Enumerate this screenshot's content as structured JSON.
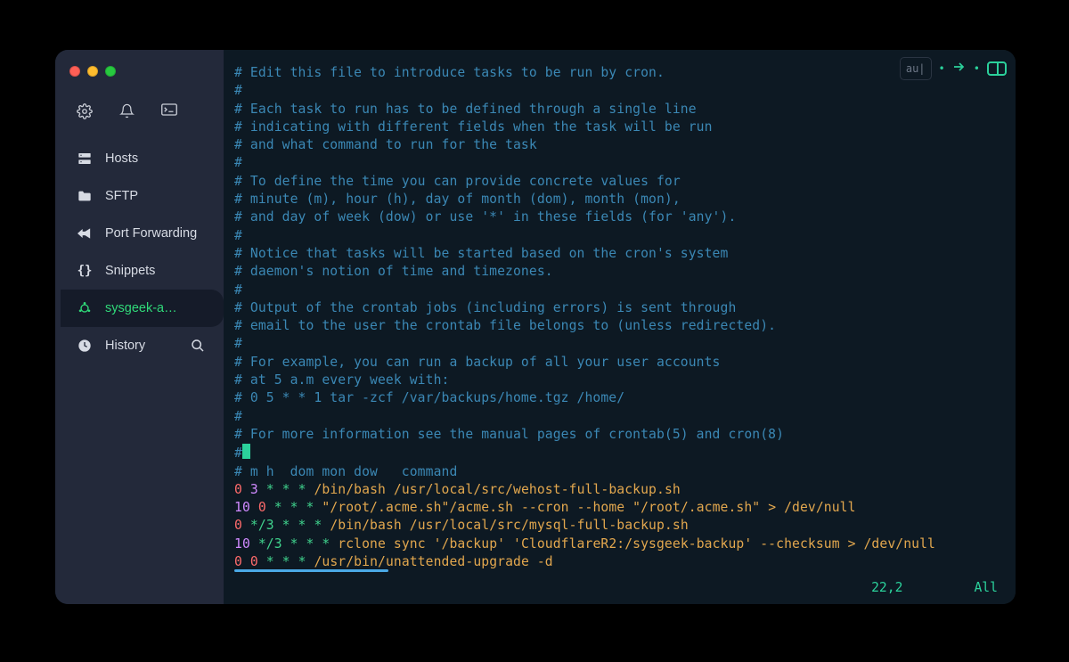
{
  "sidebar": {
    "items": [
      {
        "label": "Hosts"
      },
      {
        "label": "SFTP"
      },
      {
        "label": "Port Forwarding"
      },
      {
        "label": "Snippets"
      },
      {
        "label": "sysgeek-a…"
      },
      {
        "label": "History"
      }
    ]
  },
  "topControls": {
    "pill": "au|"
  },
  "editor": {
    "comments": [
      "# Edit this file to introduce tasks to be run by cron.",
      "#",
      "# Each task to run has to be defined through a single line",
      "# indicating with different fields when the task will be run",
      "# and what command to run for the task",
      "#",
      "# To define the time you can provide concrete values for",
      "# minute (m), hour (h), day of month (dom), month (mon),",
      "# and day of week (dow) or use '*' in these fields (for 'any').",
      "#",
      "# Notice that tasks will be started based on the cron's system",
      "# daemon's notion of time and timezones.",
      "#",
      "# Output of the crontab jobs (including errors) is sent through",
      "# email to the user the crontab file belongs to (unless redirected).",
      "#",
      "# For example, you can run a backup of all your user accounts",
      "# at 5 a.m every week with:",
      "# 0 5 * * 1 tar -zcf /var/backups/home.tgz /home/",
      "#",
      "# For more information see the manual pages of crontab(5) and cron(8)"
    ],
    "cursorLinePrefix": "#",
    "headerLine": "# m h  dom mon dow   command",
    "cronLines": [
      {
        "min": "0",
        "sep_h": " ",
        "hr": "3",
        "rest_stars": " * * * ",
        "cmd": "/bin/bash /usr/local/src/wehost-full-backup.sh"
      },
      {
        "min": "10",
        "sep_h": " ",
        "hr": "0",
        "rest_stars": " * * * ",
        "cmd": "\"/root/.acme.sh\"/acme.sh --cron --home \"/root/.acme.sh\" > /dev/null"
      },
      {
        "min": "0",
        "sep_h": " ",
        "hr": "*/3",
        "rest_stars": " * * * ",
        "cmd": "/bin/bash /usr/local/src/mysql-full-backup.sh"
      },
      {
        "min": "10",
        "sep_h": " ",
        "hr": "*/3",
        "rest_stars": " * * * ",
        "cmd": "rclone sync '/backup' 'CloudflareR2:/sysgeek-backup' --checksum > /dev/null"
      },
      {
        "min": "0",
        "sep_h": " ",
        "hr": "0",
        "rest_stars": " * * * ",
        "cmd": "/usr/bin/unattended-upgrade -d"
      }
    ],
    "status": {
      "pos": "22,2",
      "view": "All"
    }
  }
}
